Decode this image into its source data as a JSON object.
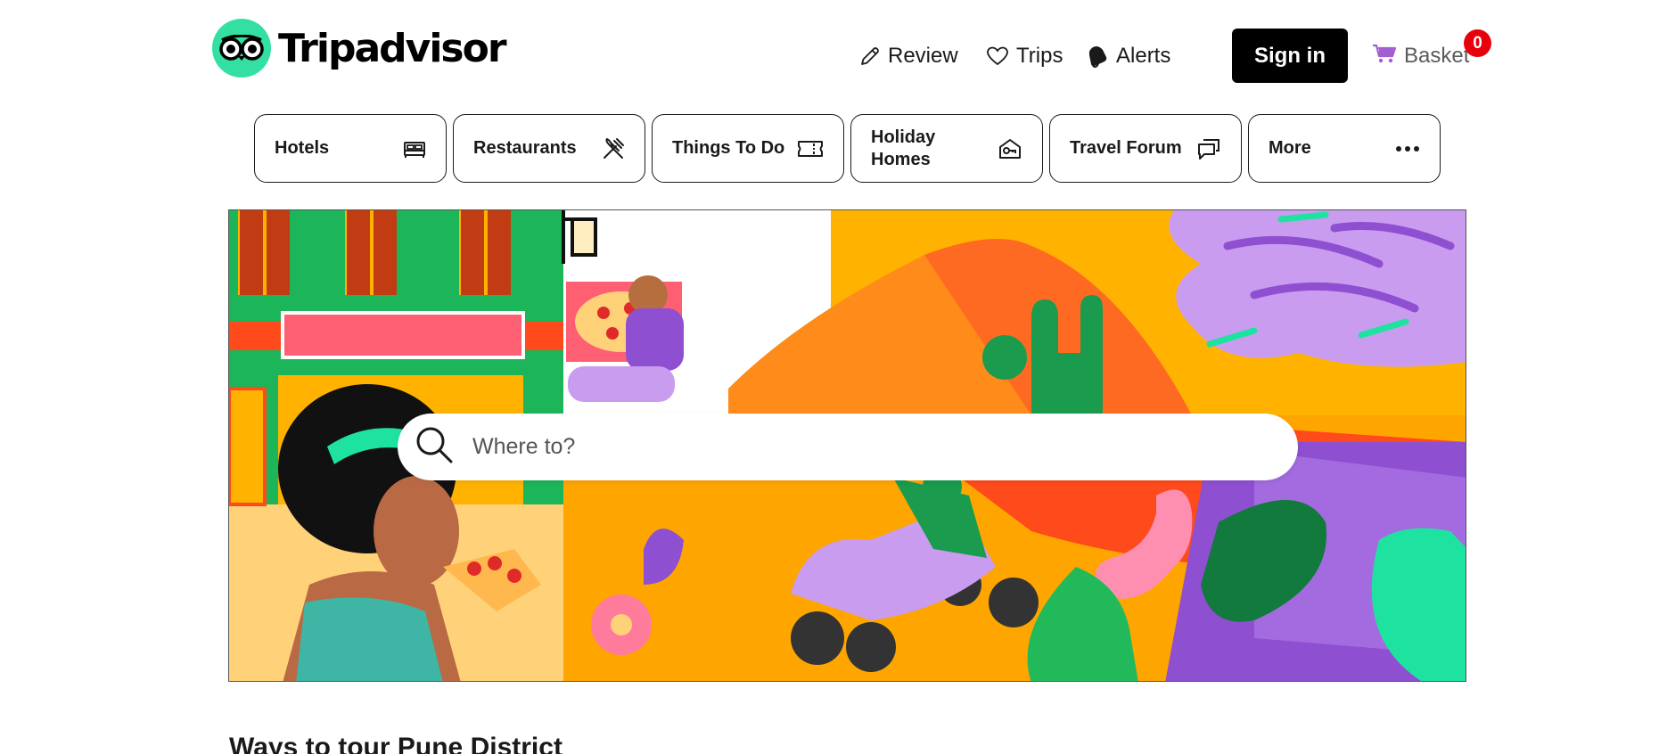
{
  "brand": {
    "name": "Tripadvisor",
    "logo_icon": "owl-eyes-icon",
    "accent": "#34e0a1"
  },
  "header": {
    "review_label": "Review",
    "trips_label": "Trips",
    "alerts_label": "Alerts",
    "sign_in_label": "Sign in",
    "basket_label": "Basket",
    "basket_count": "0"
  },
  "categories": [
    {
      "label": "Hotels",
      "icon": "bed-icon"
    },
    {
      "label": "Restaurants",
      "icon": "fork-knife-icon"
    },
    {
      "label": "Things To Do",
      "icon": "ticket-icon"
    },
    {
      "label": "Holiday Homes",
      "icon": "house-key-icon"
    },
    {
      "label": "Travel Forum",
      "icon": "chat-bubbles-icon"
    },
    {
      "label": "More",
      "icon": "ellipsis-icon"
    }
  ],
  "search": {
    "placeholder": "Where to?",
    "value": ""
  },
  "section": {
    "title": "Ways to tour Pune District"
  },
  "colors": {
    "sign_in_bg": "#000000",
    "badge": "#e8000c",
    "basket_cart": "#a25fd1"
  }
}
